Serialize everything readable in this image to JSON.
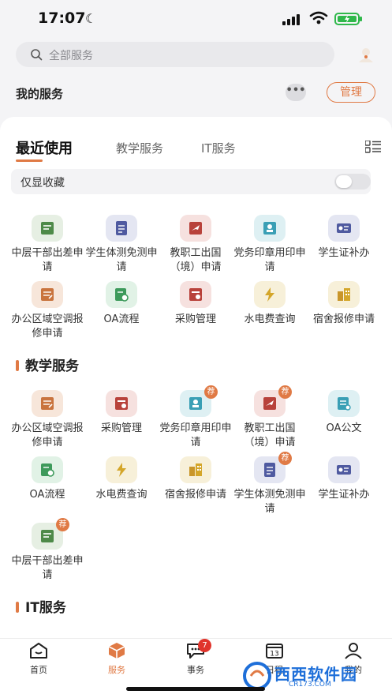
{
  "status_bar": {
    "time": "17:07"
  },
  "search": {
    "placeholder": "全部服务"
  },
  "my_services": {
    "title": "我的服务",
    "more": "•••",
    "manage": "管理"
  },
  "tabs": [
    {
      "label": "最近使用",
      "active": true
    },
    {
      "label": "教学服务",
      "active": false
    },
    {
      "label": "IT服务",
      "active": false
    }
  ],
  "favorites_only": {
    "label": "仅显收藏",
    "on": false
  },
  "recent": [
    {
      "label": "中层干部出差申请",
      "icon": "cadre-travel-icon"
    },
    {
      "label": "学生体测免测申请",
      "icon": "fitness-exempt-icon"
    },
    {
      "label": "教职工出国（境）申请",
      "icon": "abroad-icon"
    },
    {
      "label": "党务印章用印申请",
      "icon": "seal-icon"
    },
    {
      "label": "学生证补办",
      "icon": "student-card-icon"
    },
    {
      "label": "办公区域空调报修申请",
      "icon": "ac-repair-icon"
    },
    {
      "label": "OA流程",
      "icon": "oa-flow-icon"
    },
    {
      "label": "采购管理",
      "icon": "purchase-icon"
    },
    {
      "label": "水电费查询",
      "icon": "utility-bill-icon"
    },
    {
      "label": "宿舍报修申请",
      "icon": "dorm-repair-icon"
    }
  ],
  "teaching_section": {
    "title": "教学服务",
    "recommend_badge": "荐",
    "items": [
      {
        "label": "办公区域空调报修申请",
        "recommended": false
      },
      {
        "label": "采购管理",
        "recommended": false
      },
      {
        "label": "党务印章用印申请",
        "recommended": true
      },
      {
        "label": "教职工出国（境）申请",
        "recommended": true
      },
      {
        "label": "OA公文",
        "recommended": false
      },
      {
        "label": "OA流程",
        "recommended": false
      },
      {
        "label": "水电费查询",
        "recommended": false
      },
      {
        "label": "宿舍报修申请",
        "recommended": false
      },
      {
        "label": "学生体测免测申请",
        "recommended": true
      },
      {
        "label": "学生证补办",
        "recommended": false
      },
      {
        "label": "中层干部出差申请",
        "recommended": true
      }
    ]
  },
  "it_section": {
    "title": "IT服务"
  },
  "tabbar": {
    "items": [
      {
        "label": "首页"
      },
      {
        "label": "服务"
      },
      {
        "label": "事务",
        "badge": "7"
      },
      {
        "label": "日程",
        "day": "13"
      },
      {
        "label": "我的"
      }
    ]
  },
  "watermark": {
    "name": "西西软件园",
    "url": "CR173.COM"
  },
  "colors": {
    "accent": "#e07a45",
    "badge_red": "#e0342c"
  }
}
